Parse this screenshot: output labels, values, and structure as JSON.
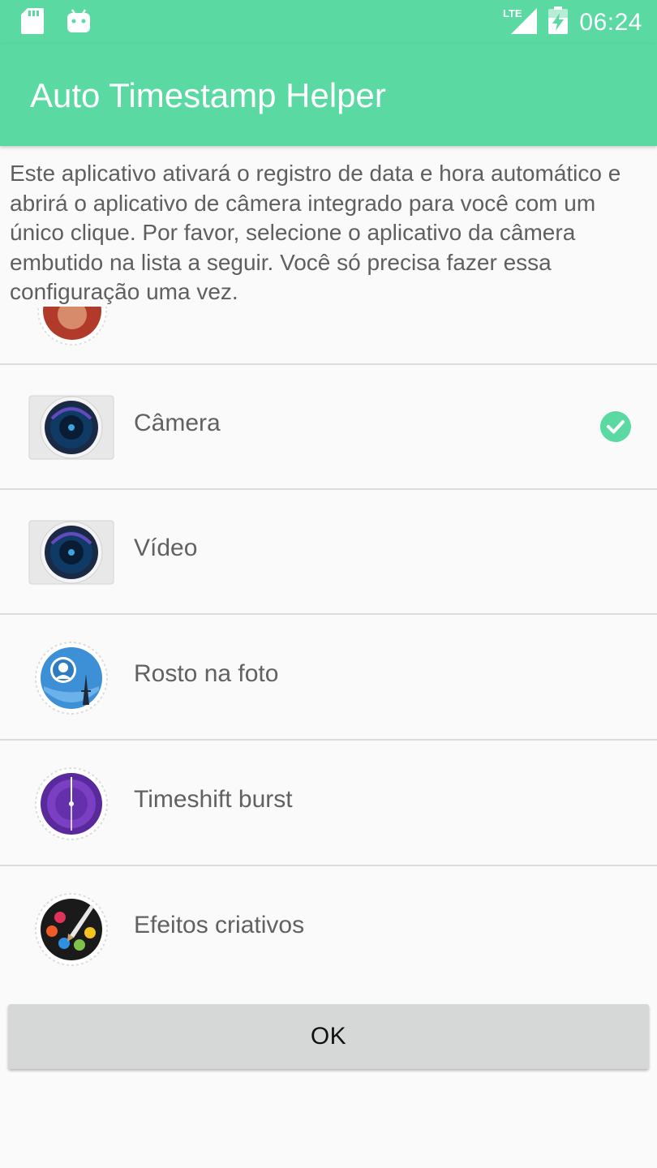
{
  "status_bar": {
    "time": "06:24",
    "network": "LTE",
    "icons": [
      "sd-card-icon",
      "android-icon",
      "lte-signal-icon",
      "battery-charging-icon"
    ]
  },
  "app_bar": {
    "title": "Auto Timestamp Helper",
    "color": "#5bd9a3"
  },
  "intro_text": "Este aplicativo ativará o registro de data e hora automático e abrirá o aplicativo de câmera integrado para você com um único clique. Por favor, selecione o aplicativo da câmera embutido na lista a seguir. Você só precisa fazer essa configuração uma vez.",
  "apps": [
    {
      "label": "",
      "icon": "partial-app-icon",
      "selected": false
    },
    {
      "label": "Câmera",
      "icon": "camera-lens-icon",
      "selected": true
    },
    {
      "label": "Vídeo",
      "icon": "video-lens-icon",
      "selected": false
    },
    {
      "label": "Rosto na foto",
      "icon": "face-in-picture-icon",
      "selected": false
    },
    {
      "label": "Timeshift burst",
      "icon": "timeshift-burst-icon",
      "selected": false
    },
    {
      "label": "Efeitos criativos",
      "icon": "creative-effects-icon",
      "selected": false
    }
  ],
  "accent_color": "#5bd9a3",
  "ok_button": {
    "label": "OK"
  }
}
